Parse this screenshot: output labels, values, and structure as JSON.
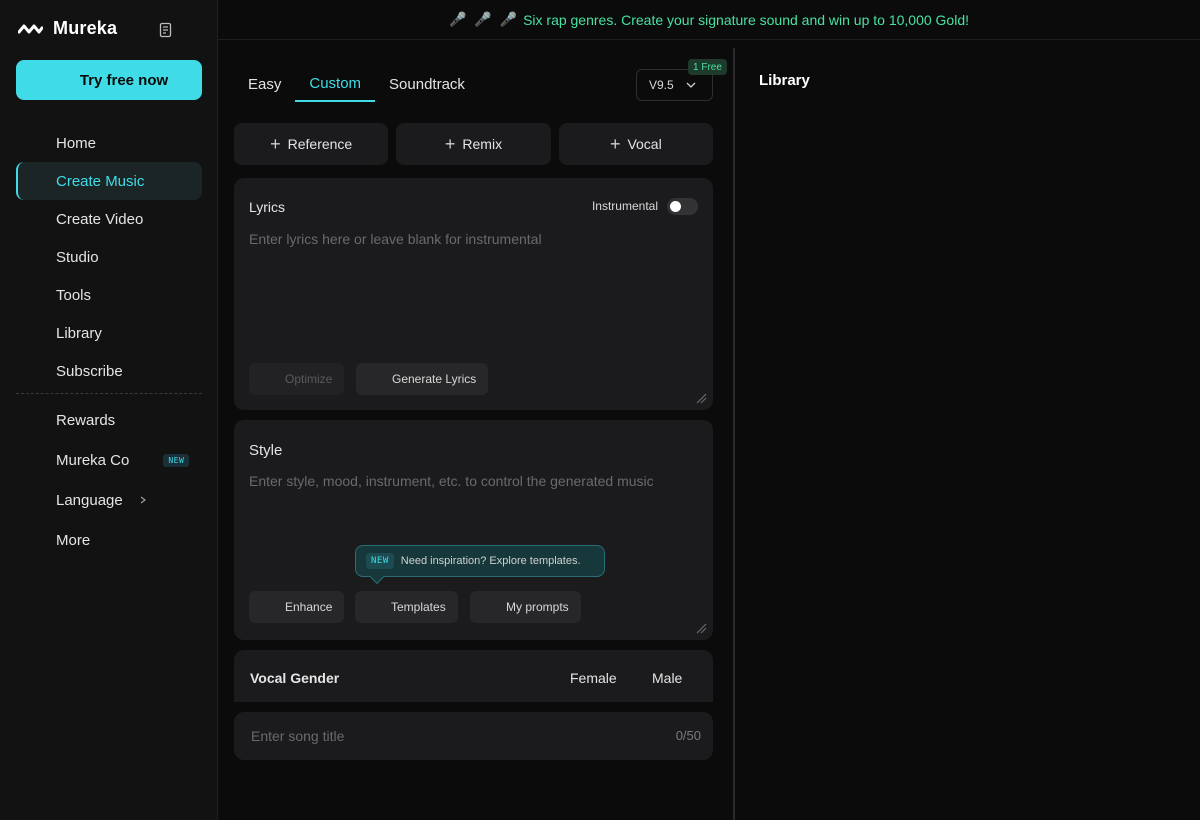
{
  "brand": {
    "name": "Mureka"
  },
  "sidebar": {
    "cta_label": "Try free now",
    "items": [
      {
        "label": "Home"
      },
      {
        "label": "Create Music"
      },
      {
        "label": "Create Video"
      },
      {
        "label": "Studio"
      },
      {
        "label": "Tools"
      },
      {
        "label": "Library"
      },
      {
        "label": "Subscribe"
      }
    ],
    "secondary": [
      {
        "label": "Rewards"
      },
      {
        "label": "Mureka Co",
        "badge": "NEW"
      },
      {
        "label": "Language"
      },
      {
        "label": "More"
      }
    ]
  },
  "banner": {
    "icons": "🎤 🎤 🎤",
    "text": "Six rap genres. Create your signature sound and win up to 10,000 Gold!"
  },
  "tabs": [
    {
      "label": "Easy"
    },
    {
      "label": "Custom"
    },
    {
      "label": "Soundtrack"
    }
  ],
  "version": {
    "value": "V9.5",
    "badge": "1 Free"
  },
  "actions": [
    {
      "label": "Reference"
    },
    {
      "label": "Remix"
    },
    {
      "label": "Vocal"
    }
  ],
  "lyrics": {
    "title": "Lyrics",
    "instrumental_label": "Instrumental",
    "placeholder": "Enter lyrics here or leave blank for instrumental",
    "optimize_label": "Optimize",
    "generate_label": "Generate Lyrics"
  },
  "style": {
    "title": "Style",
    "placeholder": "Enter style, mood, instrument, etc. to control the generated music",
    "tooltip_tag": "NEW",
    "tooltip_text": "Need inspiration? Explore templates.",
    "enhance_label": "Enhance",
    "templates_label": "Templates",
    "prompts_label": "My prompts"
  },
  "vocal_gender": {
    "title": "Vocal Gender",
    "options": [
      "Female",
      "Male"
    ]
  },
  "song_title": {
    "placeholder": "Enter song title",
    "counter": "0/50"
  },
  "library": {
    "title": "Library"
  },
  "colors": {
    "accent": "#3fdce8",
    "banner": "#48e2a0",
    "background": "#0b0b0c"
  }
}
